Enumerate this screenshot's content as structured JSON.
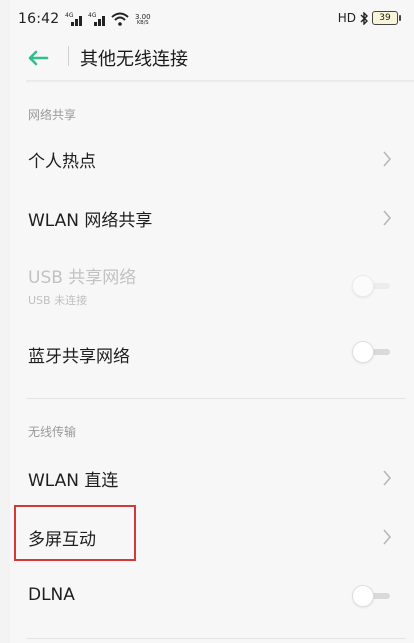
{
  "status_bar": {
    "time": "16:42",
    "signal_1_label": "4G",
    "signal_2_label": "4G",
    "net_speed_value": "3.00",
    "net_speed_unit": "KB/S",
    "hd_label": "HD",
    "battery_level": "39",
    "icons": [
      "signal-icon",
      "signal-icon",
      "wifi-icon",
      "bluetooth-icon",
      "battery-icon"
    ]
  },
  "header": {
    "title": "其他无线连接",
    "back_icon": "arrow-left-icon",
    "accent_color": "#2fbf8e"
  },
  "sections": [
    {
      "title": "网络共享",
      "items": [
        {
          "label": "个人热点",
          "control": "chevron"
        },
        {
          "label": "WLAN 网络共享",
          "control": "chevron"
        },
        {
          "label": "USB 共享网络",
          "sublabel": "USB 未连接",
          "control": "toggle",
          "state": "off",
          "disabled": true
        },
        {
          "label": "蓝牙共享网络",
          "control": "toggle",
          "state": "off"
        }
      ]
    },
    {
      "title": "无线传输",
      "items": [
        {
          "label": "WLAN 直连",
          "control": "chevron"
        },
        {
          "label": "多屏互动",
          "control": "chevron",
          "highlighted": true
        },
        {
          "label": "DLNA",
          "control": "toggle",
          "state": "off"
        }
      ]
    }
  ],
  "colors": {
    "highlight_border": "#d23a3a",
    "background": "#f7f7f7"
  }
}
